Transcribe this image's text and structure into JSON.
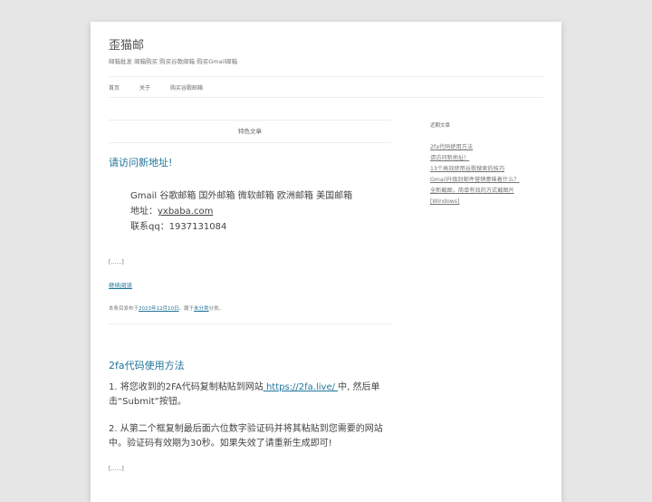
{
  "site": {
    "title": "歪猫邮",
    "description": "邮箱批发 邮箱购买 购买谷歌邮箱 购买Gmail邮箱"
  },
  "nav": {
    "items": [
      "首页",
      "关于",
      "购买谷歌邮箱"
    ]
  },
  "featured_label": "特色文章",
  "post1": {
    "title": "请访问新地址!",
    "line1": "Gmail 谷歌邮箱 国外邮箱 微软邮箱 欧洲邮箱 美国邮箱",
    "address_label": "地址：",
    "address_link": "yxbaba.com",
    "qq": "联系qq：1937131084",
    "ellipsis": "[……]",
    "continue": "继续阅读",
    "meta_prefix": "本条目发布于",
    "meta_date": "2023年12月10日",
    "meta_mid": "。属于",
    "meta_category": "未分类",
    "meta_suffix": "分类。"
  },
  "post2": {
    "title": "2fa代码使用方法",
    "p1_before": "1. 将您收到的2FA代码复制粘贴到网站",
    "p1_link": " https://2fa.live/ ",
    "p1_after": "中, 然后单击“Submit”按钮。",
    "p2": "2. 从第二个框复制最后面六位数字验证码并将其粘贴到您需要的网站中。验证码有效期为30秒。如果失效了请重新生成即可!",
    "ellipsis": "[……]"
  },
  "sidebar": {
    "title": "近期文章",
    "items": [
      "2fa代码使用方法",
      "请访问新地址！",
      "13个高效使用谷歌搜索的技巧",
      "Gmail升级封邮件营销意味着什么？",
      "全新截图，简单有效的方式截图片",
      "[Windows]"
    ]
  }
}
